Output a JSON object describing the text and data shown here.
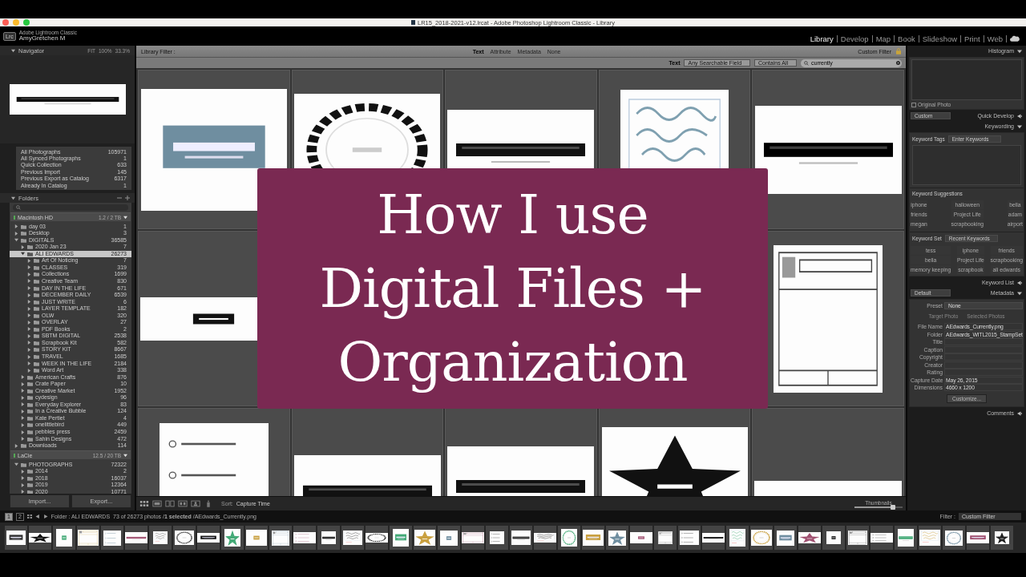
{
  "window": {
    "title": "LR15_2018-2021-v12.lrcat - Adobe Photoshop Lightroom Classic - Library"
  },
  "identity": {
    "logo": "Lrc",
    "app": "Adobe Lightroom Classic",
    "user": "AmyGretchen M"
  },
  "modules": [
    {
      "label": "Library",
      "selected": true
    },
    {
      "label": "Develop",
      "selected": false
    },
    {
      "label": "Map",
      "selected": false
    },
    {
      "label": "Book",
      "selected": false
    },
    {
      "label": "Slideshow",
      "selected": false
    },
    {
      "label": "Print",
      "selected": false
    },
    {
      "label": "Web",
      "selected": false
    }
  ],
  "navigator": {
    "title": "Navigator",
    "expanded": true,
    "zooms": [
      "FIT",
      "100%",
      "33.3%"
    ]
  },
  "catalog": [
    {
      "label": "All Photographs",
      "count": "105971"
    },
    {
      "label": "All Synced Photographs",
      "count": "1"
    },
    {
      "label": "Quick Collection",
      "count": "633"
    },
    {
      "label": "Previous Import",
      "count": "145"
    },
    {
      "label": "Previous Export as Catalog",
      "count": "6317"
    },
    {
      "label": "Already In Catalog",
      "count": "1"
    }
  ],
  "folders": {
    "title": "Folders",
    "expanded": true,
    "volumes": [
      {
        "name": "Macintosh HD",
        "space": "1.2 / 2 TB",
        "folders": [
          {
            "name": "day 03",
            "count": "1",
            "expanded": false,
            "selected": false
          },
          {
            "name": "Desktop",
            "count": "3",
            "expanded": false,
            "selected": false
          },
          {
            "name": "DIGITALS",
            "count": "36585",
            "expanded": true,
            "selected": false,
            "children": [
              {
                "name": "2020 Jan 23",
                "count": "7",
                "expanded": false,
                "selected": false
              },
              {
                "name": "ALI EDWARDS",
                "count": "26273",
                "expanded": true,
                "selected": true,
                "children": [
                  {
                    "name": "Art Of Noticing",
                    "count": "7",
                    "expanded": false,
                    "selected": false
                  },
                  {
                    "name": "CLASSES",
                    "count": "319",
                    "expanded": false,
                    "selected": false
                  },
                  {
                    "name": "Collections",
                    "count": "1699",
                    "expanded": false,
                    "selected": false
                  },
                  {
                    "name": "Creative Team",
                    "count": "830",
                    "expanded": false,
                    "selected": false
                  },
                  {
                    "name": "DAY IN THE LIFE",
                    "count": "671",
                    "expanded": false,
                    "selected": false
                  },
                  {
                    "name": "DECEMBER DAILY",
                    "count": "6539",
                    "expanded": false,
                    "selected": false
                  },
                  {
                    "name": "JUST WRITE",
                    "count": "6",
                    "expanded": false,
                    "selected": false
                  },
                  {
                    "name": "LAYER TEMPLATE",
                    "count": "182",
                    "expanded": false,
                    "selected": false
                  },
                  {
                    "name": "OLW",
                    "count": "320",
                    "expanded": false,
                    "selected": false
                  },
                  {
                    "name": "OVERLAY",
                    "count": "27",
                    "expanded": false,
                    "selected": false
                  },
                  {
                    "name": "PDF Books",
                    "count": "2",
                    "expanded": false,
                    "selected": false
                  },
                  {
                    "name": "SBTM DIGITAL",
                    "count": "2538",
                    "expanded": false,
                    "selected": false
                  },
                  {
                    "name": "Scrapbook Kit",
                    "count": "582",
                    "expanded": false,
                    "selected": false
                  },
                  {
                    "name": "STORY KIT",
                    "count": "8667",
                    "expanded": false,
                    "selected": false
                  },
                  {
                    "name": "TRAVEL",
                    "count": "1685",
                    "expanded": false,
                    "selected": false
                  },
                  {
                    "name": "WEEK IN THE LIFE",
                    "count": "2184",
                    "expanded": false,
                    "selected": false
                  },
                  {
                    "name": "Word Art",
                    "count": "338",
                    "expanded": false,
                    "selected": false
                  }
                ]
              },
              {
                "name": "American Crafts",
                "count": "876",
                "expanded": false,
                "selected": false
              },
              {
                "name": "Crate Paper",
                "count": "10",
                "expanded": false,
                "selected": false
              },
              {
                "name": "Creative Market",
                "count": "1952",
                "expanded": false,
                "selected": false
              },
              {
                "name": "cydesign",
                "count": "96",
                "expanded": false,
                "selected": false
              },
              {
                "name": "Everyday Explorer",
                "count": "83",
                "expanded": false,
                "selected": false
              },
              {
                "name": "In a Creative Bubble",
                "count": "124",
                "expanded": false,
                "selected": false
              },
              {
                "name": "Kate Pertiet",
                "count": "4",
                "expanded": false,
                "selected": false
              },
              {
                "name": "onelittlebird",
                "count": "449",
                "expanded": false,
                "selected": false
              },
              {
                "name": "pebbles press",
                "count": "2459",
                "expanded": false,
                "selected": false
              },
              {
                "name": "Sahin Designs",
                "count": "472",
                "expanded": false,
                "selected": false
              }
            ]
          },
          {
            "name": "Downloads",
            "count": "114",
            "expanded": false,
            "selected": false
          }
        ]
      },
      {
        "name": "LaCie",
        "space": "12.5 / 20 TB",
        "folders": [
          {
            "name": "PHOTOGRAPHS",
            "count": "72322",
            "expanded": true,
            "selected": false,
            "children": [
              {
                "name": "2014",
                "count": "2",
                "expanded": false,
                "selected": false
              },
              {
                "name": "2018",
                "count": "16037",
                "expanded": false,
                "selected": false
              },
              {
                "name": "2019",
                "count": "12364",
                "expanded": false,
                "selected": false
              },
              {
                "name": "2020",
                "count": "10771",
                "expanded": false,
                "selected": false
              }
            ]
          }
        ]
      }
    ]
  },
  "left_buttons": [
    "Import...",
    "Export..."
  ],
  "library_filter": {
    "label": "Library Filter :",
    "tabs": [
      {
        "label": "Text",
        "selected": true
      },
      {
        "label": "Attribute",
        "selected": false
      },
      {
        "label": "Metadata",
        "selected": false
      },
      {
        "label": "None",
        "selected": false
      }
    ],
    "preset": "Custom Filter",
    "text_label": "Text",
    "field": "Any Searchable Field",
    "rule": "Contains All",
    "search": "currently"
  },
  "toolbar": {
    "sort_label": "Sort:",
    "sort": "Capture Time",
    "thumbnails_label": "Thumbnails",
    "thumbnails": {
      "level": 0.8
    }
  },
  "filmstrip_bar": {
    "screens": [
      {
        "label": "1",
        "selected": true
      },
      {
        "label": "2",
        "selected": false
      }
    ],
    "source": "Folder : ALI EDWARDS",
    "info": "73 of 26273 photos /**1 selected** /AEdwards_Currently.png",
    "filter_label": "Filter :",
    "filter": "Custom Filter"
  },
  "right_panels": {
    "histogram": {
      "title": "Histogram",
      "expanded": true,
      "original_photo": {
        "label": "Original Photo",
        "checked": false
      }
    },
    "quick_develop": {
      "title": "Quick Develop",
      "expanded": false,
      "preset": "Custom"
    },
    "keywording": {
      "title": "Keywording",
      "expanded": true,
      "tags_label": "Keyword Tags",
      "tags_placeholder": "Enter Keywords",
      "suggestions_title": "Keyword Suggestions",
      "suggestions": [
        "iphone",
        "halloween",
        "bella",
        "friends",
        "Project Life",
        "adam",
        "megan",
        "scrapbooking",
        "airport"
      ],
      "set_label": "Keyword Set",
      "set": "Recent Keywords",
      "set_keywords": [
        "tess",
        "iphone",
        "friends",
        "bella",
        "Project Life",
        "scrapbooking",
        "memory keeping",
        "scrapbook",
        "ali edwards"
      ]
    },
    "keyword_list": {
      "title": "Keyword List",
      "expanded": false
    },
    "metadata": {
      "title": "Metadata",
      "expanded": true,
      "preset_dropdown": "Default",
      "preset_label": "Preset",
      "preset": "None",
      "targets": [
        "Target Photo",
        "Selected Photos"
      ],
      "fields": [
        {
          "label": "File Name",
          "value": "AEdwards_Currently.png"
        },
        {
          "label": "Folder",
          "value": "AEdwards_WITL2015_StampSet"
        },
        {
          "label": "Title"
        },
        {
          "label": "Caption"
        },
        {
          "label": "Copyright"
        },
        {
          "label": "Creator"
        },
        {
          "label": "Rating"
        },
        {
          "label": "Capture Date",
          "value": "May 26, 2015"
        },
        {
          "label": "Dimensions",
          "value": "4660 x 1200"
        }
      ],
      "customize": "Customize..."
    },
    "comments": {
      "title": "Comments",
      "expanded": false
    }
  },
  "banner": {
    "lines": [
      "How I use",
      "Digital Files +",
      "Organization"
    ]
  }
}
